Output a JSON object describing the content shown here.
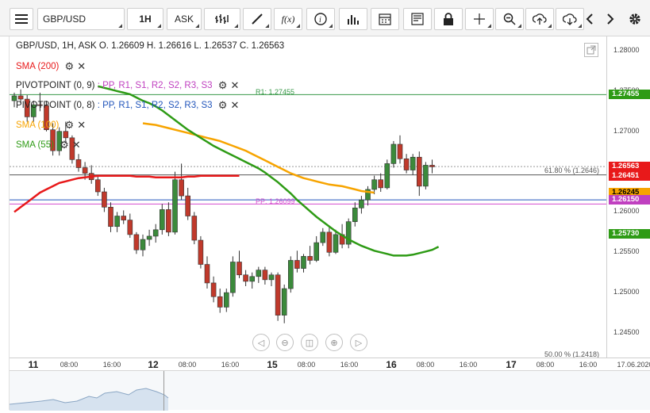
{
  "toolbar": {
    "symbol": "GBP/USD",
    "timeframe": "1H",
    "price_type": "ASK",
    "icons": [
      "menu-icon",
      "bar-type-icon",
      "draw-icon",
      "function-icon",
      "info-icon",
      "volume-icon",
      "calendar-icon",
      "news-icon",
      "lock-icon",
      "crosshair-icon",
      "zoom-icon",
      "upload-icon",
      "download-icon",
      "arrow-left-icon",
      "arrow-right-icon",
      "gear-icon"
    ]
  },
  "header": {
    "ohlc": "GBP/USD, 1H, ASK   O. 1.26609  H. 1.26616  L. 1.26537  C. 1.26563"
  },
  "legend": {
    "sma200": "SMA (200)",
    "pivot1": "PIVOTPOINT (0, 9)",
    "pivot1_items": ": PP, R1, S1, R2, S2, R3, S3",
    "pivot2": "PIVOTPOINT (0, 8)",
    "pivot2_items": ": PP, R1, S1, R2, S2, R3, S3",
    "sma100": "SMA (100)",
    "sma55": "SMA (55)"
  },
  "colors": {
    "sma200": "#e8191a",
    "sma100": "#f7a400",
    "sma55": "#2e9b15",
    "bull": "#3b8a3b",
    "bear": "#c0392b",
    "r1": "#3a9a4a",
    "pp": "#d54ccf",
    "pivot1_items": "#c040c0",
    "accent_blue": "#2255bb"
  },
  "annotations": {
    "r1": "R1: 1.27455",
    "pp": "PP: 1.26099",
    "fib618": "61.80 % (1.2646)",
    "fib50": "50.00 % (1.2418)"
  },
  "price_axis": {
    "ticks": [
      "1.28000",
      "1.27500",
      "1.27000",
      "1.26500",
      "1.26000",
      "1.25500",
      "1.25000",
      "1.24500"
    ],
    "tags": [
      {
        "value": "1.27455",
        "bg": "#2e9b15",
        "fg": "#ffffff"
      },
      {
        "value": "1.26563",
        "bg": "#e8191a",
        "fg": "#ffffff"
      },
      {
        "value": "1.26451",
        "bg": "#e8191a",
        "fg": "#ffffff"
      },
      {
        "value": "1.26245",
        "bg": "#f7a400",
        "fg": "#000000"
      },
      {
        "value": "1.26150",
        "bg": "#c040c0",
        "fg": "#ffffff"
      },
      {
        "value": "1.25730",
        "bg": "#2e9b15",
        "fg": "#ffffff"
      }
    ]
  },
  "time_axis": {
    "labels": [
      {
        "text": "11",
        "big": true
      },
      {
        "text": "08:00"
      },
      {
        "text": "16:00"
      },
      {
        "text": "12",
        "big": true
      },
      {
        "text": "08:00"
      },
      {
        "text": "16:00"
      },
      {
        "text": "15",
        "big": true
      },
      {
        "text": "08:00"
      },
      {
        "text": "16:00"
      },
      {
        "text": "16",
        "big": true
      },
      {
        "text": "08:00"
      },
      {
        "text": "16:00"
      },
      {
        "text": "17",
        "big": true
      },
      {
        "text": "08:00"
      },
      {
        "text": "16:00"
      },
      {
        "text": "17.06.2020"
      }
    ]
  },
  "chart_data": {
    "type": "candlestick",
    "ylim": [
      1.2418,
      1.2843
    ],
    "candles": [
      [
        1.2738,
        1.2748,
        1.273,
        1.2744
      ],
      [
        1.2744,
        1.2752,
        1.2735,
        1.274
      ],
      [
        1.274,
        1.2745,
        1.2712,
        1.2718
      ],
      [
        1.2718,
        1.2738,
        1.2712,
        1.2733
      ],
      [
        1.2733,
        1.2748,
        1.2725,
        1.2732
      ],
      [
        1.2732,
        1.2738,
        1.27,
        1.2702
      ],
      [
        1.2702,
        1.271,
        1.267,
        1.2676
      ],
      [
        1.2676,
        1.2705,
        1.267,
        1.27
      ],
      [
        1.27,
        1.2712,
        1.2685,
        1.2692
      ],
      [
        1.2692,
        1.2695,
        1.266,
        1.2665
      ],
      [
        1.2665,
        1.2672,
        1.265,
        1.2655
      ],
      [
        1.2655,
        1.2662,
        1.264,
        1.2648
      ],
      [
        1.2648,
        1.2658,
        1.2635,
        1.264
      ],
      [
        1.264,
        1.2646,
        1.262,
        1.2625
      ],
      [
        1.2625,
        1.263,
        1.26,
        1.2606
      ],
      [
        1.2606,
        1.2612,
        1.2575,
        1.2582
      ],
      [
        1.2582,
        1.26,
        1.2575,
        1.2595
      ],
      [
        1.2595,
        1.2602,
        1.2585,
        1.259
      ],
      [
        1.259,
        1.2598,
        1.2568,
        1.2572
      ],
      [
        1.2572,
        1.2575,
        1.2548,
        1.2553
      ],
      [
        1.2553,
        1.2572,
        1.2545,
        1.2566
      ],
      [
        1.2566,
        1.2578,
        1.2558,
        1.257
      ],
      [
        1.257,
        1.2585,
        1.2562,
        1.2578
      ],
      [
        1.2578,
        1.261,
        1.2572,
        1.2603
      ],
      [
        1.2603,
        1.2612,
        1.257,
        1.2575
      ],
      [
        1.2575,
        1.265,
        1.2572,
        1.264
      ],
      [
        1.264,
        1.266,
        1.2615,
        1.262
      ],
      [
        1.262,
        1.263,
        1.259,
        1.2595
      ],
      [
        1.2595,
        1.26,
        1.256,
        1.2565
      ],
      [
        1.2565,
        1.257,
        1.253,
        1.2535
      ],
      [
        1.2535,
        1.2545,
        1.2505,
        1.2512
      ],
      [
        1.2512,
        1.252,
        1.2488,
        1.2495
      ],
      [
        1.2495,
        1.2505,
        1.2475,
        1.2482
      ],
      [
        1.2482,
        1.2505,
        1.2476,
        1.25
      ],
      [
        1.25,
        1.2545,
        1.2495,
        1.2538
      ],
      [
        1.2538,
        1.2552,
        1.2518,
        1.2522
      ],
      [
        1.2522,
        1.2528,
        1.2508,
        1.2514
      ],
      [
        1.2514,
        1.2525,
        1.2505,
        1.252
      ],
      [
        1.252,
        1.2532,
        1.2512,
        1.2528
      ],
      [
        1.2528,
        1.2532,
        1.251,
        1.2516
      ],
      [
        1.2516,
        1.2525,
        1.2508,
        1.2522
      ],
      [
        1.2522,
        1.2525,
        1.2465,
        1.2472
      ],
      [
        1.2472,
        1.251,
        1.2462,
        1.2505
      ],
      [
        1.2505,
        1.2545,
        1.25,
        1.254
      ],
      [
        1.254,
        1.2552,
        1.2525,
        1.253
      ],
      [
        1.253,
        1.2548,
        1.2525,
        1.2545
      ],
      [
        1.2545,
        1.2558,
        1.2535,
        1.254
      ],
      [
        1.254,
        1.257,
        1.2538,
        1.2562
      ],
      [
        1.2562,
        1.258,
        1.2558,
        1.2575
      ],
      [
        1.2575,
        1.2582,
        1.2545,
        1.255
      ],
      [
        1.255,
        1.2578,
        1.2548,
        1.2572
      ],
      [
        1.2572,
        1.2585,
        1.2555,
        1.256
      ],
      [
        1.256,
        1.2592,
        1.2555,
        1.2588
      ],
      [
        1.2588,
        1.2612,
        1.2582,
        1.2605
      ],
      [
        1.2605,
        1.262,
        1.2598,
        1.2615
      ],
      [
        1.2615,
        1.2632,
        1.2608,
        1.2628
      ],
      [
        1.2628,
        1.2645,
        1.2622,
        1.264
      ],
      [
        1.264,
        1.2648,
        1.2625,
        1.263
      ],
      [
        1.263,
        1.2665,
        1.2628,
        1.266
      ],
      [
        1.266,
        1.2688,
        1.2655,
        1.2684
      ],
      [
        1.2684,
        1.2695,
        1.266,
        1.2666
      ],
      [
        1.2666,
        1.2672,
        1.2648,
        1.2652
      ],
      [
        1.2652,
        1.2672,
        1.2646,
        1.2668
      ],
      [
        1.2668,
        1.2675,
        1.262,
        1.2632
      ],
      [
        1.2632,
        1.2662,
        1.2628,
        1.2658
      ],
      [
        1.2658,
        1.2665,
        1.2648,
        1.2656
      ]
    ],
    "sma55": [
      1.2756,
      1.2754,
      1.2752,
      1.275,
      1.2748,
      1.2746,
      1.2742,
      1.2738,
      1.2735,
      1.2731,
      1.2726,
      1.272,
      1.2714,
      1.2708,
      1.2702,
      1.2697,
      1.2692,
      1.2687,
      1.2682,
      1.2678,
      1.2674,
      1.267,
      1.2666,
      1.2662,
      1.2658,
      1.2654,
      1.2649,
      1.2643,
      1.2637,
      1.263,
      1.2623,
      1.2615,
      1.2608,
      1.2601,
      1.2594,
      1.2588,
      1.2582,
      1.2576,
      1.2571,
      1.2566,
      1.2562,
      1.2558,
      1.2555,
      1.2552,
      1.255,
      1.2548,
      1.2546,
      1.2546,
      1.2546,
      1.2547,
      1.2549,
      1.2551,
      1.2553,
      1.2557
    ],
    "sma100": [
      1.271,
      1.2709,
      1.2708,
      1.2706,
      1.2704,
      1.2702,
      1.27,
      1.2698,
      1.2696,
      1.2694,
      1.2692,
      1.269,
      1.2688,
      1.2685,
      1.2682,
      1.2679,
      1.2676,
      1.2672,
      1.2668,
      1.2664,
      1.266,
      1.2656,
      1.2652,
      1.2648,
      1.2645,
      1.2642,
      1.264,
      1.2638,
      1.2636,
      1.2634,
      1.2633,
      1.2632,
      1.263,
      1.2628,
      1.2626,
      1.2625,
      1.2624
    ],
    "sma200": [
      1.26,
      1.2606,
      1.2612,
      1.2618,
      1.2624,
      1.2628,
      1.2632,
      1.2636,
      1.2638,
      1.264,
      1.2642,
      1.2643,
      1.2644,
      1.2645,
      1.2645,
      1.2645,
      1.2645,
      1.2645,
      1.2645,
      1.2644,
      1.2644,
      1.2644,
      1.2643,
      1.2643,
      1.2643,
      1.2643,
      1.2643,
      1.2644,
      1.2644,
      1.2645,
      1.2645,
      1.2645,
      1.2645,
      1.2645,
      1.2645,
      1.2645
    ]
  }
}
